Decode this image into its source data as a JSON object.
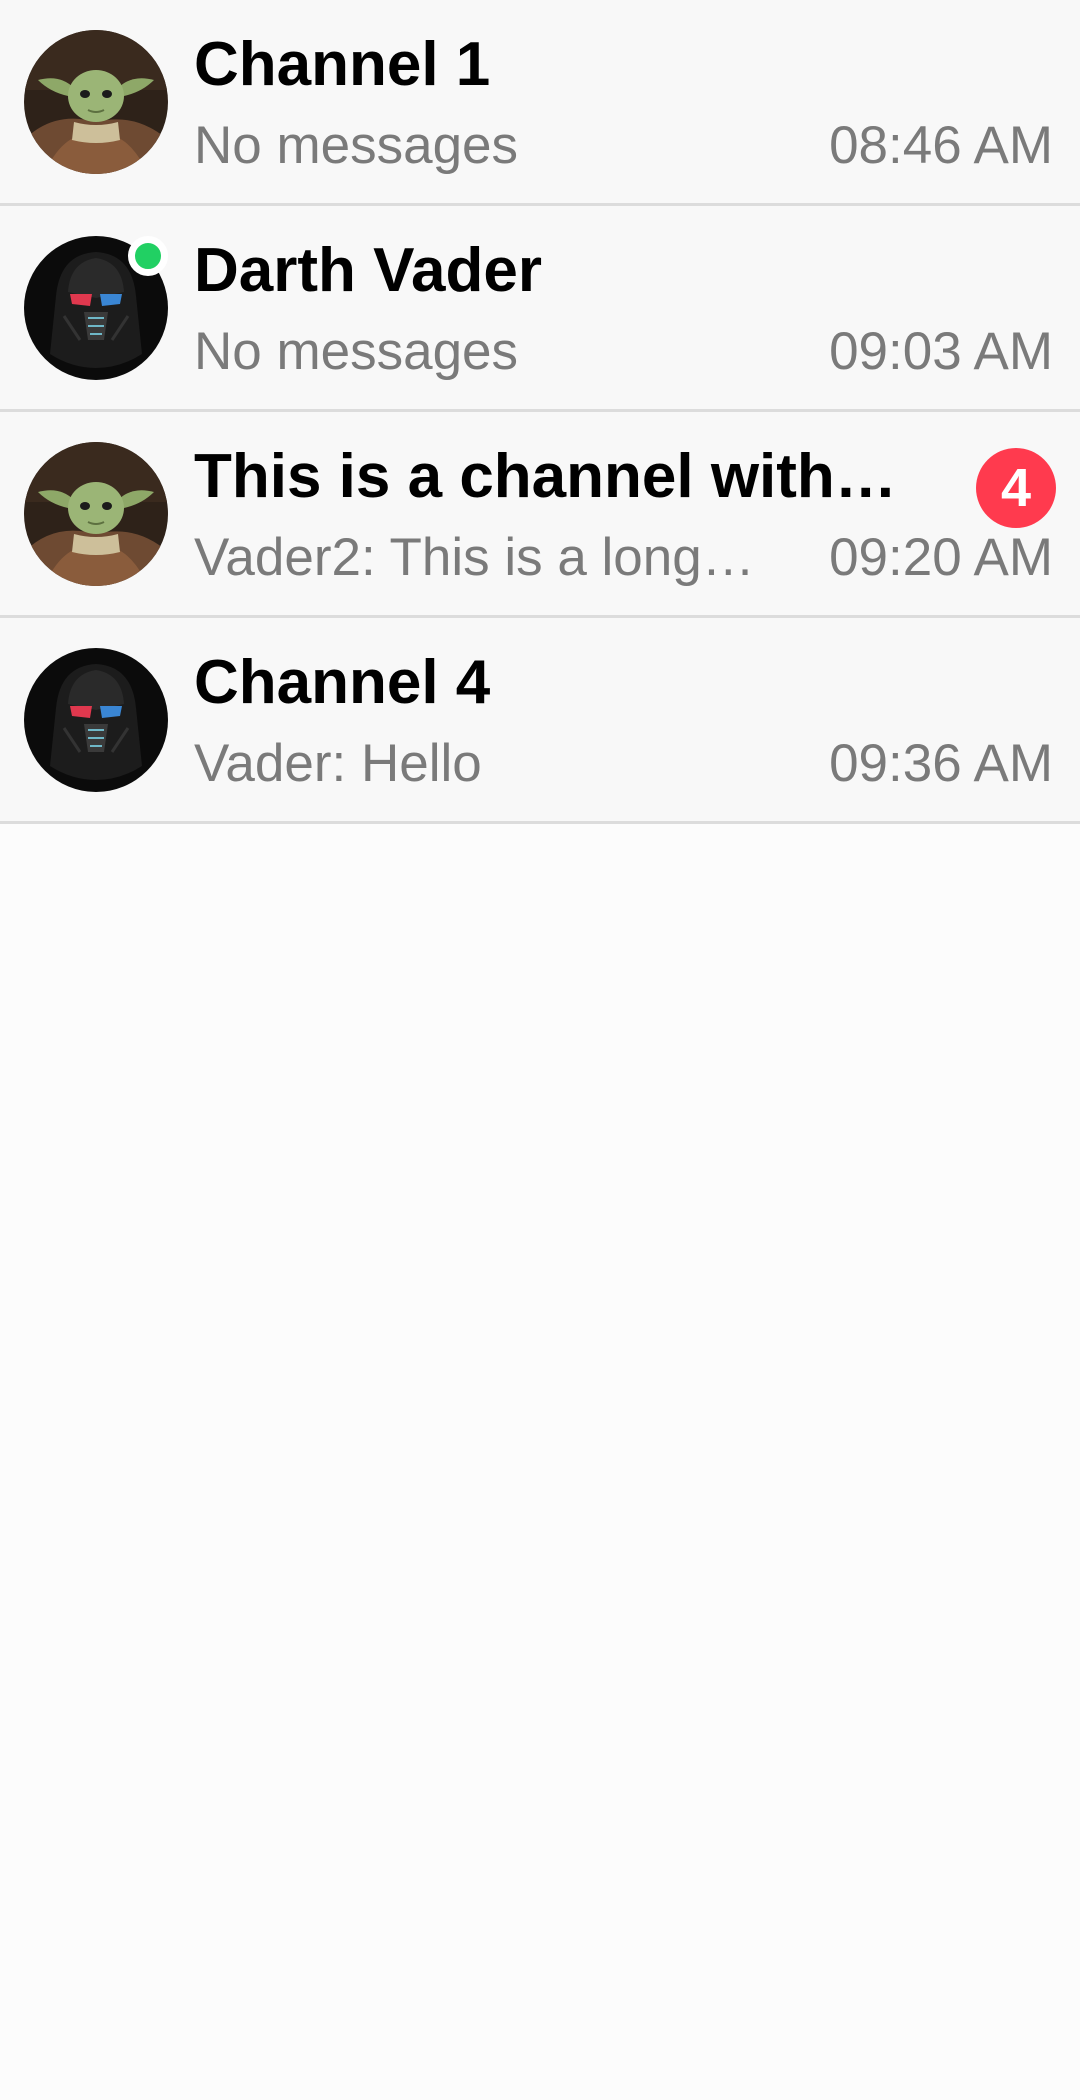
{
  "colors": {
    "online": "#21d063",
    "badge": "#ff3a4e",
    "title": "#000000",
    "secondary": "#7a7a7a",
    "divider": "#dcdcdc"
  },
  "channels": [
    {
      "name": "Channel 1",
      "preview": "No messages",
      "time": "08:46 AM",
      "avatar": "yoda-avatar",
      "online": false,
      "unread": ""
    },
    {
      "name": "Darth Vader",
      "preview": "No messages",
      "time": "09:03 AM",
      "avatar": "vader-avatar",
      "online": true,
      "unread": ""
    },
    {
      "name": "This is a channel with…",
      "preview": "Vader2: This is a long…",
      "time": "09:20 AM",
      "avatar": "yoda-avatar",
      "online": false,
      "unread": "4"
    },
    {
      "name": "Channel 4",
      "preview": "Vader: Hello",
      "time": "09:36 AM",
      "avatar": "vader-avatar",
      "online": false,
      "unread": ""
    }
  ]
}
